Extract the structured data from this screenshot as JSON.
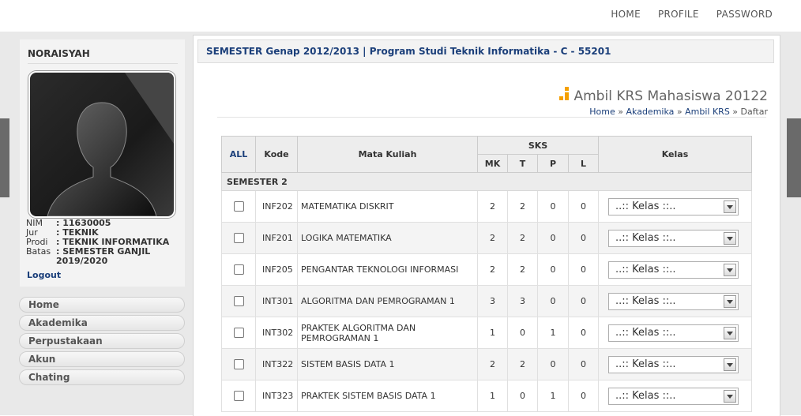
{
  "topnav": {
    "home": "HOME",
    "profile": "PROFILE",
    "password": "PASSWORD"
  },
  "profile": {
    "name": "NORAISYAH",
    "info": [
      {
        "key": "NIM",
        "value": ": 11630005"
      },
      {
        "key": "Jur",
        "value": ": TEKNIK"
      },
      {
        "key": "Prodi",
        "value": ": TEKNIK INFORMATIKA"
      },
      {
        "key": "Batas",
        "value": ": SEMESTER GANJIL 2019/2020"
      }
    ],
    "logout": "Logout"
  },
  "menu": [
    "Home",
    "Akademika",
    "Perpustakaan",
    "Akun",
    "Chating"
  ],
  "main": {
    "semester_bar": "SEMESTER Genap 2012/2013 | Program Studi Teknik Informatika - C - 55201",
    "page_title": "Ambil KRS Mahasiswa 20122",
    "breadcrumb": {
      "home": "Home",
      "sep": " » ",
      "akademika": "Akademika",
      "ambil_krs": "Ambil KRS",
      "current": "Daftar"
    }
  },
  "table": {
    "headers": {
      "all": "ALL",
      "kode": "Kode",
      "mata_kuliah": "Mata Kuliah",
      "sks": "SKS",
      "kelas": "Kelas"
    },
    "sks_sub": [
      "MK",
      "T",
      "P",
      "L"
    ],
    "semester_label": "SEMESTER 2",
    "select_placeholder": "..:: Kelas ::..",
    "rows": [
      {
        "kode": "INF202",
        "mk": "MATEMATIKA DISKRIT",
        "sks_mk": "2",
        "t": "2",
        "p": "0",
        "l": "0"
      },
      {
        "kode": "INF201",
        "mk": "LOGIKA MATEMATIKA",
        "sks_mk": "2",
        "t": "2",
        "p": "0",
        "l": "0"
      },
      {
        "kode": "INF205",
        "mk": "PENGANTAR TEKNOLOGI INFORMASI",
        "sks_mk": "2",
        "t": "2",
        "p": "0",
        "l": "0"
      },
      {
        "kode": "INT301",
        "mk": "ALGORITMA DAN PEMROGRAMAN 1",
        "sks_mk": "3",
        "t": "3",
        "p": "0",
        "l": "0"
      },
      {
        "kode": "INT302",
        "mk": "PRAKTEK ALGORITMA DAN PEMROGRAMAN 1",
        "sks_mk": "1",
        "t": "0",
        "p": "1",
        "l": "0"
      },
      {
        "kode": "INT322",
        "mk": "SISTEM BASIS DATA 1",
        "sks_mk": "2",
        "t": "2",
        "p": "0",
        "l": "0"
      },
      {
        "kode": "INT323",
        "mk": "PRAKTEK SISTEM BASIS DATA 1",
        "sks_mk": "1",
        "t": "0",
        "p": "1",
        "l": "0"
      }
    ]
  },
  "colors": {
    "link": "#1b3f7a",
    "accent": "#f5a000"
  }
}
